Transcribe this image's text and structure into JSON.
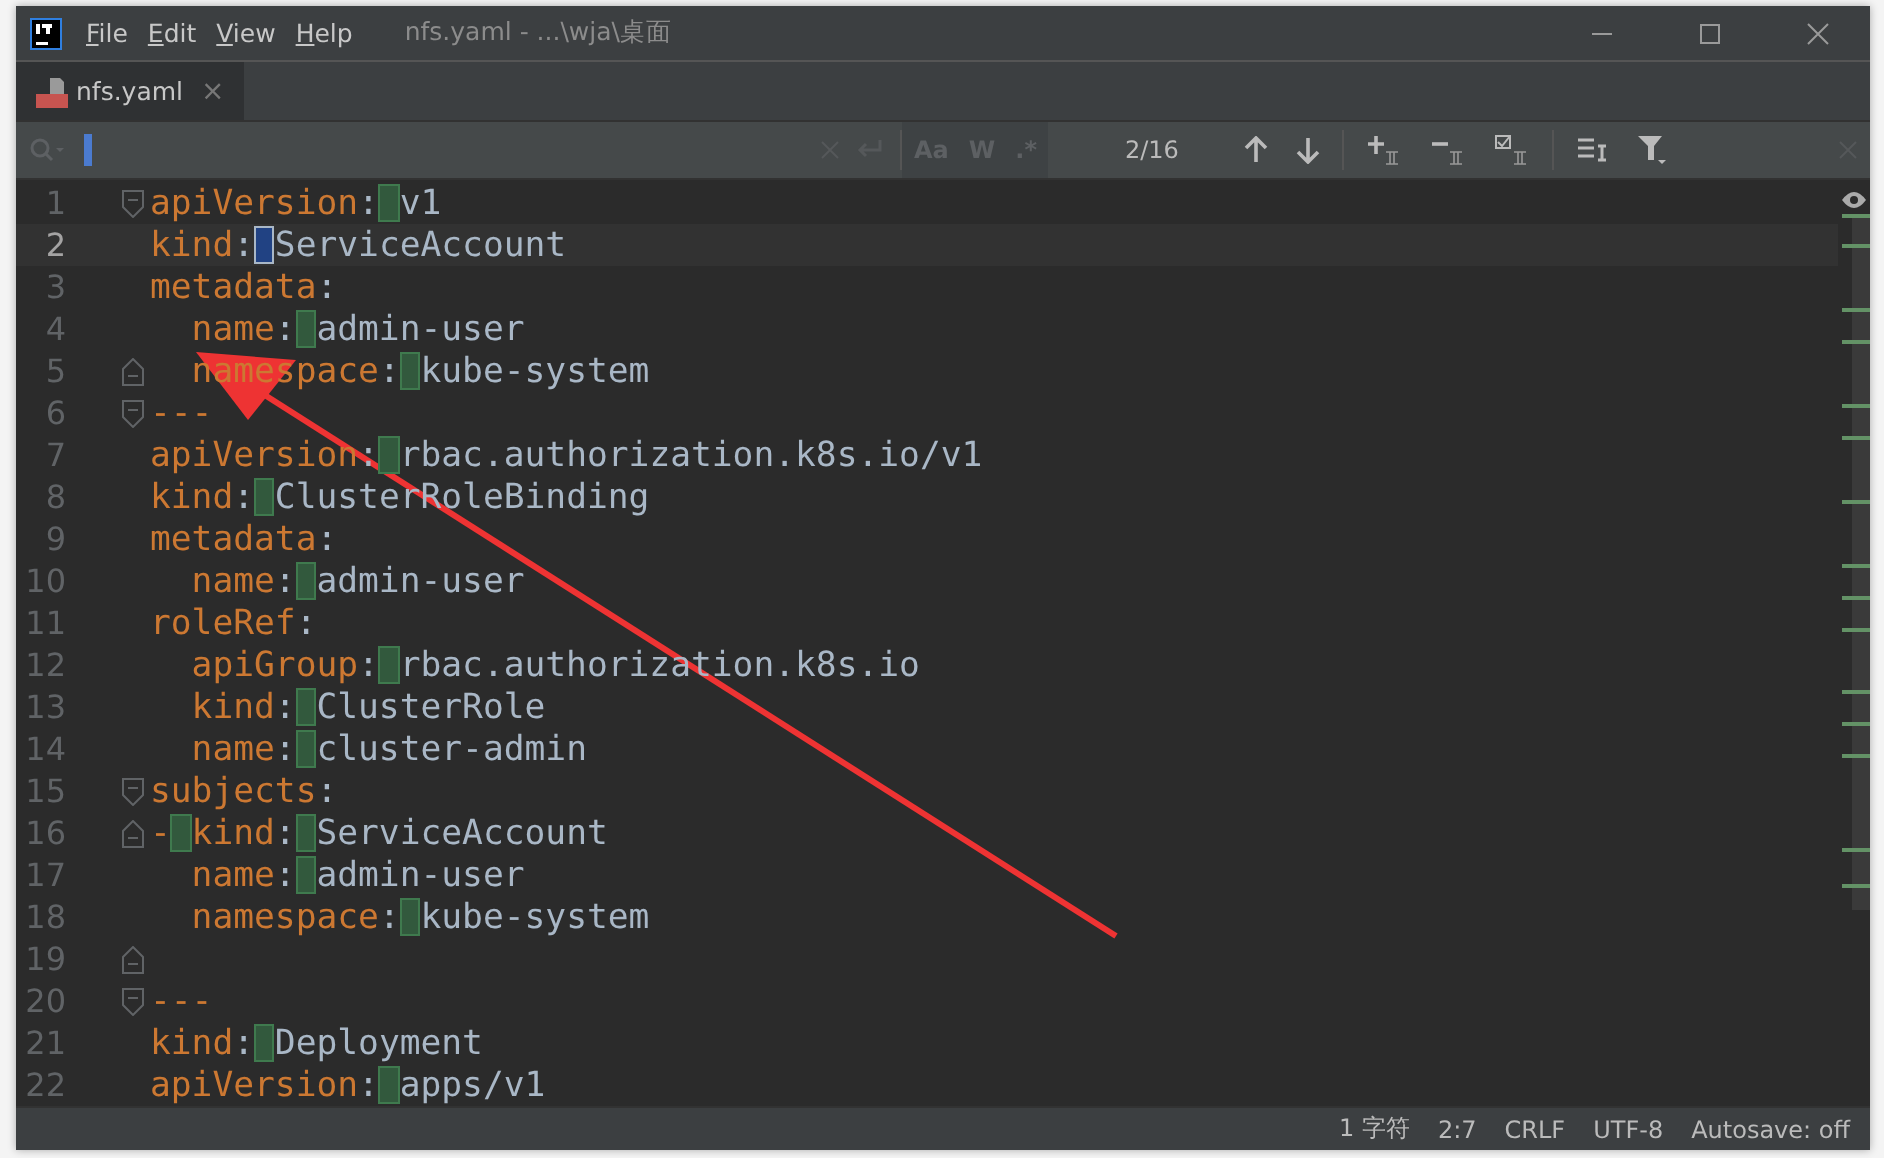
{
  "window": {
    "title": "nfs.yaml - ...\\wja\\桌面",
    "menu": [
      {
        "label": "File"
      },
      {
        "label": "Edit"
      },
      {
        "label": "View"
      },
      {
        "label": "Help"
      }
    ]
  },
  "tabs": [
    {
      "label": "nfs.yaml",
      "selected": true,
      "close": "×"
    }
  ],
  "find_bar": {
    "match_case": "Aa",
    "words": "W",
    "regex": ".*",
    "count": "2/16"
  },
  "editor": {
    "lines": [
      {
        "number": "1",
        "current": false,
        "indented": false,
        "fold_open": true,
        "fold_close": false,
        "segments": [
          {
            "kind": "key",
            "text": "apiVersion"
          },
          {
            "kind": "punct",
            "text": ":"
          },
          {
            "kind": "match",
            "selected": false
          },
          {
            "kind": "value",
            "text": "v1"
          }
        ]
      },
      {
        "number": "2",
        "current": true,
        "indented": false,
        "fold_open": false,
        "fold_close": false,
        "segments": [
          {
            "kind": "key",
            "text": "kind"
          },
          {
            "kind": "punct",
            "text": ":"
          },
          {
            "kind": "match",
            "selected": true
          },
          {
            "kind": "value",
            "text": "ServiceAccount"
          }
        ]
      },
      {
        "number": "3",
        "current": false,
        "indented": false,
        "fold_open": false,
        "fold_close": false,
        "segments": [
          {
            "kind": "key",
            "text": "metadata"
          },
          {
            "kind": "punct",
            "text": ":"
          }
        ]
      },
      {
        "number": "4",
        "current": false,
        "indented": true,
        "fold_open": false,
        "fold_close": false,
        "segments": [
          {
            "kind": "key",
            "text": "name"
          },
          {
            "kind": "punct",
            "text": ":"
          },
          {
            "kind": "match",
            "selected": false
          },
          {
            "kind": "value",
            "text": "admin-user"
          }
        ]
      },
      {
        "number": "5",
        "current": false,
        "indented": true,
        "fold_open": false,
        "fold_close": true,
        "segments": [
          {
            "kind": "key",
            "text": "namespace"
          },
          {
            "kind": "punct",
            "text": ":"
          },
          {
            "kind": "match",
            "selected": false
          },
          {
            "kind": "value",
            "text": "kube-system"
          }
        ]
      },
      {
        "number": "6",
        "current": false,
        "indented": false,
        "fold_open": true,
        "fold_close": false,
        "segments": [
          {
            "kind": "punct",
            "text": "---"
          }
        ]
      },
      {
        "number": "7",
        "current": false,
        "indented": false,
        "fold_open": false,
        "fold_close": false,
        "segments": [
          {
            "kind": "key",
            "text": "apiVersion"
          },
          {
            "kind": "punct",
            "text": ":"
          },
          {
            "kind": "match",
            "selected": false
          },
          {
            "kind": "value",
            "text": "rbac.authorization.k8s.io/v1"
          }
        ]
      },
      {
        "number": "8",
        "current": false,
        "indented": false,
        "fold_open": false,
        "fold_close": false,
        "segments": [
          {
            "kind": "key",
            "text": "kind"
          },
          {
            "kind": "punct",
            "text": ":"
          },
          {
            "kind": "match",
            "selected": false
          },
          {
            "kind": "value",
            "text": "ClusterRoleBinding"
          }
        ]
      },
      {
        "number": "9",
        "current": false,
        "indented": false,
        "fold_open": false,
        "fold_close": false,
        "segments": [
          {
            "kind": "key",
            "text": "metadata"
          },
          {
            "kind": "punct",
            "text": ":"
          }
        ]
      },
      {
        "number": "10",
        "current": false,
        "indented": true,
        "fold_open": false,
        "fold_close": false,
        "segments": [
          {
            "kind": "key",
            "text": "name"
          },
          {
            "kind": "punct",
            "text": ":"
          },
          {
            "kind": "match",
            "selected": false
          },
          {
            "kind": "value",
            "text": "admin-user"
          }
        ]
      },
      {
        "number": "11",
        "current": false,
        "indented": false,
        "fold_open": false,
        "fold_close": false,
        "segments": [
          {
            "kind": "key",
            "text": "roleRef"
          },
          {
            "kind": "punct",
            "text": ":"
          }
        ]
      },
      {
        "number": "12",
        "current": false,
        "indented": true,
        "fold_open": false,
        "fold_close": false,
        "segments": [
          {
            "kind": "key",
            "text": "apiGroup"
          },
          {
            "kind": "punct",
            "text": ":"
          },
          {
            "kind": "match",
            "selected": false
          },
          {
            "kind": "value",
            "text": "rbac.authorization.k8s.io"
          }
        ]
      },
      {
        "number": "13",
        "current": false,
        "indented": true,
        "fold_open": false,
        "fold_close": false,
        "segments": [
          {
            "kind": "key",
            "text": "kind"
          },
          {
            "kind": "punct",
            "text": ":"
          },
          {
            "kind": "match",
            "selected": false
          },
          {
            "kind": "value",
            "text": "ClusterRole"
          }
        ]
      },
      {
        "number": "14",
        "current": false,
        "indented": true,
        "fold_open": false,
        "fold_close": false,
        "segments": [
          {
            "kind": "key",
            "text": "name"
          },
          {
            "kind": "punct",
            "text": ":"
          },
          {
            "kind": "match",
            "selected": false
          },
          {
            "kind": "value",
            "text": "cluster-admin"
          }
        ]
      },
      {
        "number": "15",
        "current": false,
        "indented": false,
        "fold_open": true,
        "fold_close": false,
        "segments": [
          {
            "kind": "key",
            "text": "subjects"
          },
          {
            "kind": "punct",
            "text": ":"
          }
        ]
      },
      {
        "number": "16",
        "current": false,
        "indented": false,
        "fold_open": false,
        "fold_close": true,
        "segments": [
          {
            "kind": "punct",
            "text": "-"
          },
          {
            "kind": "match",
            "selected": false
          },
          {
            "kind": "key",
            "text": "kind"
          },
          {
            "kind": "punct",
            "text": ":"
          },
          {
            "kind": "match",
            "selected": false
          },
          {
            "kind": "value",
            "text": "ServiceAccount"
          }
        ]
      },
      {
        "number": "17",
        "current": false,
        "indented": true,
        "fold_open": false,
        "fold_close": false,
        "segments": [
          {
            "kind": "key",
            "text": "name"
          },
          {
            "kind": "punct",
            "text": ":"
          },
          {
            "kind": "match",
            "selected": false
          },
          {
            "kind": "value",
            "text": "admin-user"
          }
        ]
      },
      {
        "number": "18",
        "current": false,
        "indented": true,
        "fold_open": false,
        "fold_close": false,
        "segments": [
          {
            "kind": "key",
            "text": "namespace"
          },
          {
            "kind": "punct",
            "text": ":"
          },
          {
            "kind": "match",
            "selected": false
          },
          {
            "kind": "value",
            "text": "kube-system"
          }
        ]
      },
      {
        "number": "19",
        "current": false,
        "fold_open": false,
        "fold_close": true
      },
      {
        "number": "20",
        "current": false,
        "indented": false,
        "fold_open": true,
        "fold_close": false,
        "segments": [
          {
            "kind": "punct",
            "text": "---"
          }
        ]
      },
      {
        "number": "21",
        "current": false,
        "indented": false,
        "fold_open": false,
        "fold_close": false,
        "segments": [
          {
            "kind": "key",
            "text": "kind"
          },
          {
            "kind": "punct",
            "text": ":"
          },
          {
            "kind": "match",
            "selected": false
          },
          {
            "kind": "value",
            "text": "Deployment"
          }
        ]
      },
      {
        "number": "22",
        "current": false,
        "indented": false,
        "fold_open": false,
        "fold_close": false,
        "segments": [
          {
            "kind": "key",
            "text": "apiVersion"
          },
          {
            "kind": "punct",
            "text": ":"
          },
          {
            "kind": "match",
            "selected": false
          },
          {
            "kind": "value",
            "text": "apps/v1"
          }
        ]
      }
    ]
  },
  "status_bar": [
    "1 字符",
    "2:7",
    "CRLF",
    "UTF-8",
    "Autosave: off"
  ]
}
